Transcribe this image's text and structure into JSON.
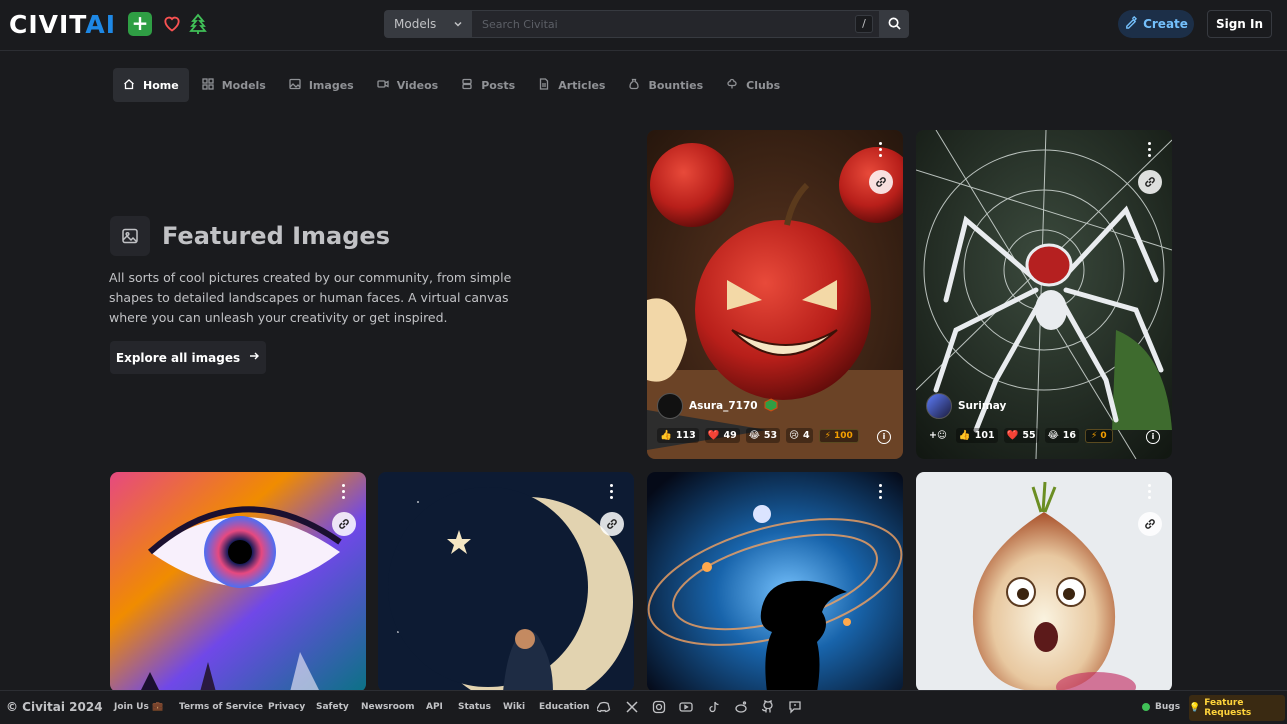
{
  "header": {
    "logo_main": "CIVIT",
    "logo_accent": "AI",
    "plus_label": "+",
    "search": {
      "type_value": "Models",
      "placeholder": "Search Civitai",
      "shortcut": "/"
    },
    "create_label": "Create",
    "signin_label": "Sign In"
  },
  "nav": [
    {
      "label": "Home",
      "icon": "home-icon",
      "active": true
    },
    {
      "label": "Models",
      "icon": "grid-icon"
    },
    {
      "label": "Images",
      "icon": "image-icon"
    },
    {
      "label": "Videos",
      "icon": "video-icon"
    },
    {
      "label": "Posts",
      "icon": "posts-icon"
    },
    {
      "label": "Articles",
      "icon": "article-icon"
    },
    {
      "label": "Bounties",
      "icon": "moneybag-icon"
    },
    {
      "label": "Clubs",
      "icon": "clubs-icon"
    }
  ],
  "featured": {
    "title": "Featured Images",
    "description": "All sorts of cool pictures created by our community, from simple shapes to detailed landscapes or human faces. A virtual canvas where you can unleash your creativity or get inspired.",
    "explore_label": "Explore all images"
  },
  "cards": [
    {
      "subject": "apple",
      "user": "Asura_7170",
      "reactions": {
        "like": "113",
        "heart": "49",
        "laugh": "53",
        "cry": "4"
      },
      "buzz": "100"
    },
    {
      "subject": "spider",
      "user": "Surimay",
      "reactions": {
        "like": "101",
        "heart": "55",
        "laugh": "16"
      },
      "buzz": "0"
    },
    {
      "subject": "eye"
    },
    {
      "subject": "moon"
    },
    {
      "subject": "galaxy-woman"
    },
    {
      "subject": "onion"
    }
  ],
  "footer": {
    "copyright": "© Civitai 2024",
    "links": [
      "Join Us 💼",
      "Terms of Service",
      "Privacy",
      "Safety",
      "Newsroom",
      "API",
      "Status",
      "Wiki",
      "Education"
    ],
    "bugs_label": "Bugs",
    "feature_requests_label": "Feature Requests"
  },
  "colors": {
    "bg": "#1a1b1e",
    "accent_blue": "#1e88e5",
    "accent_green": "#2f9e44",
    "buzz_orange": "#f59f00"
  }
}
